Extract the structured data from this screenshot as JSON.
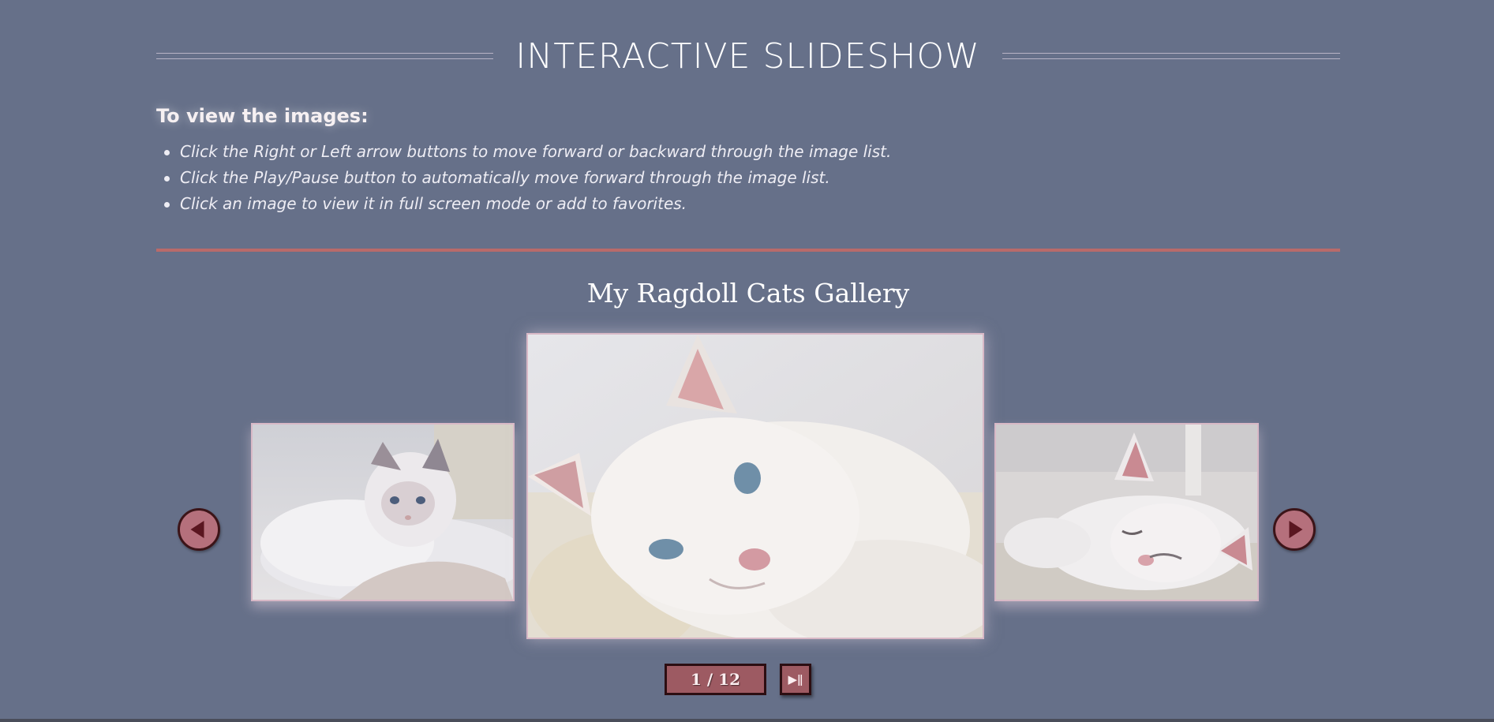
{
  "header": {
    "title": "INTERACTIVE SLIDESHOW"
  },
  "instructions": {
    "heading": "To view the images:",
    "items": [
      "Click the Right or Left arrow buttons to move forward or backward through the image list.",
      "Click the Play/Pause button to automatically move forward through the image list.",
      "Click an image to view it in full screen mode or add to favorites."
    ]
  },
  "gallery": {
    "title": "My Ragdoll Cats Gallery",
    "counter": "1 / 12",
    "play_pause_glyph": "▶ǁ",
    "prev_icon": "left-arrow-icon",
    "next_icon": "right-arrow-icon"
  },
  "colors": {
    "background": "#667089",
    "accent_line": "#b96a6a",
    "button_fill": "#9d5a62",
    "arrow_fill": "#b5707c"
  }
}
